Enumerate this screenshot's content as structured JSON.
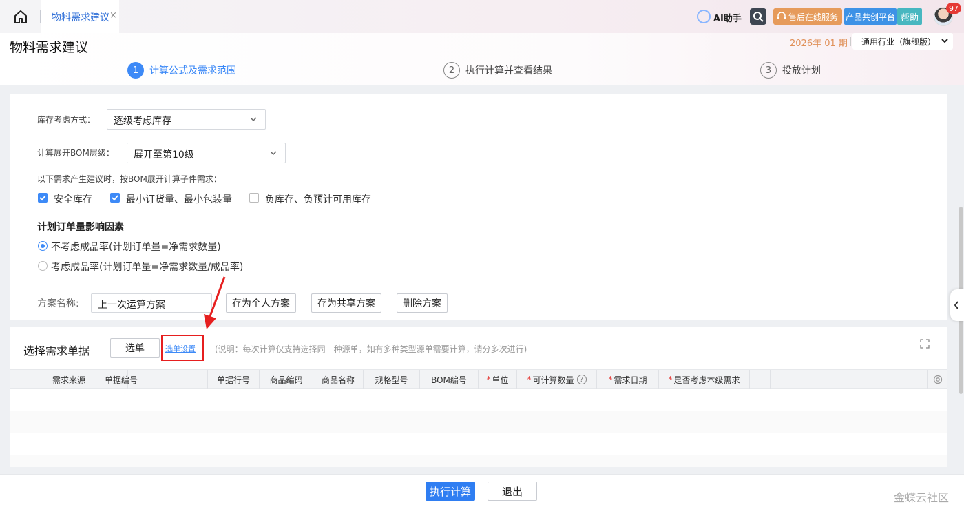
{
  "topbar": {
    "tab_label": "物料需求建议",
    "tab_close": "×",
    "ai_label": "AI助手",
    "service_label": "售后在线服务",
    "platform_label": "产品共创平台",
    "help_label": "帮助",
    "notification_count": "97"
  },
  "header": {
    "page_title": "物料需求建议",
    "period": "2026年 01 期",
    "industry": "通用行业（旗舰版）",
    "steps": [
      {
        "num": "1",
        "label": "计算公式及需求范围"
      },
      {
        "num": "2",
        "label": "执行计算并查看结果"
      },
      {
        "num": "3",
        "label": "投放计划"
      }
    ]
  },
  "form": {
    "stock_label": "库存考虑方式：",
    "stock_value": "逐级考虑库存",
    "bom_label": "计算展开BOM层级：",
    "bom_value": "展开至第10级",
    "demand_note": "以下需求产生建议时，按BOM展开计算子件需求：",
    "checkboxes": [
      {
        "label": "安全库存",
        "checked": true
      },
      {
        "label": "最小订货量、最小包装量",
        "checked": true
      },
      {
        "label": "负库存、负预计可用库存",
        "checked": false
      }
    ],
    "factor_title": "计划订单量影响因素",
    "radios": [
      {
        "label": "不考虑成品率(计划订单量=净需求数量)",
        "checked": true
      },
      {
        "label": "考虑成品率(计划订单量=净需求数量/成品率)",
        "checked": false
      }
    ],
    "scheme_label": "方案名称:",
    "scheme_value": "上一次运算方案",
    "btn_save_personal": "存为个人方案",
    "btn_save_shared": "存为共享方案",
    "btn_delete": "删除方案"
  },
  "selection": {
    "title": "选择需求单据",
    "select_btn": "选单",
    "settings_link": "选单设置",
    "note": "(说明：每次计算仅支持选择同一种源单，如有多种类型源单需要计算，请分多次进行)",
    "required_mark": "*",
    "columns": [
      {
        "label": "需求来源",
        "required": false
      },
      {
        "label": "单据编号",
        "required": false
      },
      {
        "label": "单据行号",
        "required": false
      },
      {
        "label": "商品编码",
        "required": false
      },
      {
        "label": "商品名称",
        "required": false
      },
      {
        "label": "规格型号",
        "required": false
      },
      {
        "label": "BOM编号",
        "required": false
      },
      {
        "label": "单位",
        "required": true
      },
      {
        "label": "可计算数量",
        "required": true
      },
      {
        "label": "需求日期",
        "required": true
      },
      {
        "label": "是否考虑本级需求",
        "required": true
      }
    ],
    "help_icon": "?"
  },
  "footer": {
    "execute_label": "执行计算",
    "exit_label": "退出",
    "watermark": "金蝶云社区"
  },
  "colors": {
    "accent": "#3d8af7",
    "service": "#e69b5b",
    "platform": "#3d92e6",
    "help": "#47b7c0",
    "annotation": "#e61f1f"
  }
}
